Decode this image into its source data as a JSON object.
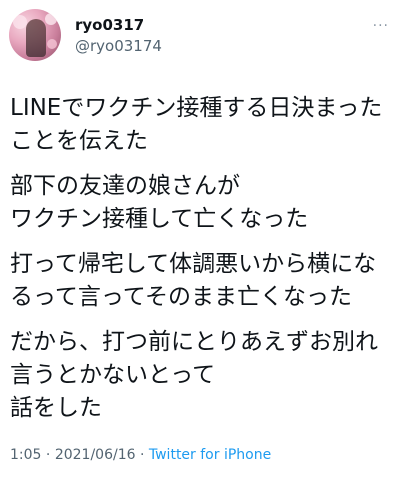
{
  "user": {
    "display_name": "ryo0317",
    "handle": "@ryo03174"
  },
  "more_menu": "···",
  "tweet": {
    "paragraphs": [
      [
        "LINEでワクチン接種する日決まった",
        "ことを伝えた"
      ],
      [
        "部下の友達の娘さんが",
        "ワクチン接種して亡くなった"
      ],
      [
        "打って帰宅して体調悪いから横にな",
        "るって言ってそのまま亡くなった"
      ],
      [
        "だから、打つ前にとりあえずお別れ",
        "言うとかないとって",
        "話をした"
      ]
    ]
  },
  "meta": {
    "time": "1:05",
    "separator": " · ",
    "date": "2021/06/16",
    "separator2": " · ",
    "source": "Twitter for iPhone"
  }
}
